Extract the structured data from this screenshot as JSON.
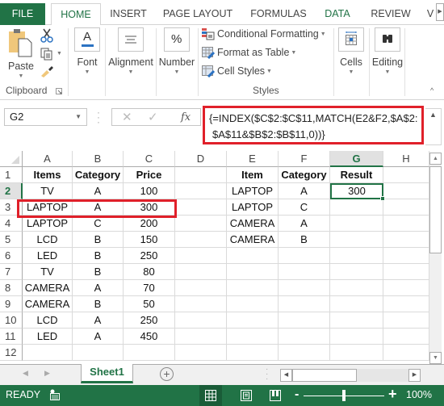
{
  "tabs": {
    "file": "FILE",
    "items": [
      {
        "label": "HOME",
        "active": true
      },
      {
        "label": "INSERT"
      },
      {
        "label": "PAGE LAYOUT"
      },
      {
        "label": "FORMULAS"
      },
      {
        "label": "DATA"
      },
      {
        "label": "REVIEW"
      },
      {
        "label": "V"
      }
    ]
  },
  "ribbon": {
    "clipboard": {
      "paste": "Paste",
      "group": "Clipboard"
    },
    "font": "Font",
    "alignment": "Alignment",
    "number": "Number",
    "number_icon": "%",
    "styles": {
      "conditional": "Conditional Formatting",
      "format_table": "Format as Table",
      "cell_styles": "Cell Styles",
      "group": "Styles"
    },
    "cells": "Cells",
    "editing": "Editing"
  },
  "formula_bar": {
    "name_box": "G2",
    "cancel": "✕",
    "enter": "✓",
    "fx": "fx",
    "formula_line1": "{=INDEX($C$2:$C$11,MATCH(E2&F2,$A$2:",
    "formula_line2": "$A$11&$B$2:$B$11,0))}"
  },
  "grid": {
    "columns": [
      "A",
      "B",
      "C",
      "D",
      "E",
      "F",
      "G",
      "H"
    ],
    "selected_column": "G",
    "rows": [
      "1",
      "2",
      "3",
      "4",
      "5",
      "6",
      "7",
      "8",
      "9",
      "10",
      "11",
      "12"
    ],
    "selected_row": "2",
    "active_cell": "G2",
    "table1": {
      "headers": [
        "Items",
        "Category",
        "Price"
      ],
      "rows": [
        [
          "TV",
          "A",
          "100"
        ],
        [
          "LAPTOP",
          "A",
          "300"
        ],
        [
          "LAPTOP",
          "C",
          "200"
        ],
        [
          "LCD",
          "B",
          "150"
        ],
        [
          "LED",
          "B",
          "250"
        ],
        [
          "TV",
          "B",
          "80"
        ],
        [
          "CAMERA",
          "A",
          "70"
        ],
        [
          "CAMERA",
          "B",
          "50"
        ],
        [
          "LCD",
          "A",
          "250"
        ],
        [
          "LED",
          "A",
          "450"
        ]
      ]
    },
    "table2": {
      "headers": [
        "Item",
        "Category",
        "Result"
      ],
      "rows": [
        [
          "LAPTOP",
          "A",
          "300"
        ],
        [
          "LAPTOP",
          "C",
          ""
        ],
        [
          "CAMERA",
          "A",
          ""
        ],
        [
          "CAMERA",
          "B",
          ""
        ]
      ]
    }
  },
  "sheets": {
    "tabs": [
      "Sheet1"
    ],
    "add": "+"
  },
  "status": {
    "mode": "READY",
    "zoom": "100%",
    "zoom_minus": "-",
    "zoom_plus": "+",
    "zoom_level": 100
  },
  "colors": {
    "accent": "#217346",
    "highlight": "#e0202a"
  }
}
